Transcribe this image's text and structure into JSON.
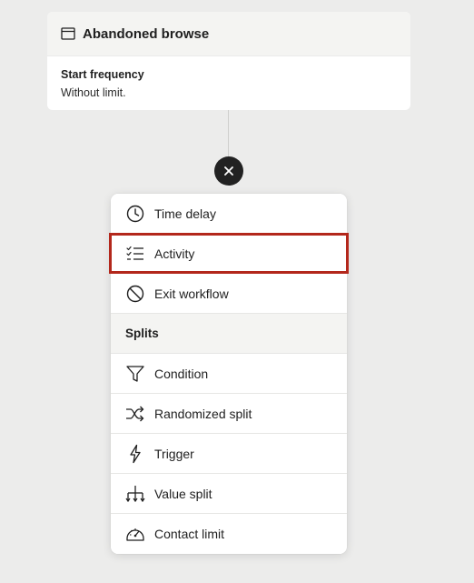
{
  "trigger": {
    "icon": "browser-window-icon",
    "title": "Abandoned browse",
    "frequency_label": "Start frequency",
    "frequency_value": "Without limit."
  },
  "close_button": {
    "icon": "close-icon"
  },
  "menu": {
    "items_top": [
      {
        "label": "Time delay",
        "icon": "clock-icon"
      },
      {
        "label": "Activity",
        "icon": "checklist-icon"
      },
      {
        "label": "Exit workflow",
        "icon": "prohibit-icon"
      }
    ],
    "section_title": "Splits",
    "items_splits": [
      {
        "label": "Condition",
        "icon": "funnel-icon"
      },
      {
        "label": "Randomized split",
        "icon": "shuffle-icon"
      },
      {
        "label": "Trigger",
        "icon": "lightning-icon"
      },
      {
        "label": "Value split",
        "icon": "branch-arrows-icon"
      },
      {
        "label": "Contact limit",
        "icon": "gauge-icon"
      }
    ],
    "highlighted_item": "Activity",
    "highlight_color": "#b3271b"
  }
}
